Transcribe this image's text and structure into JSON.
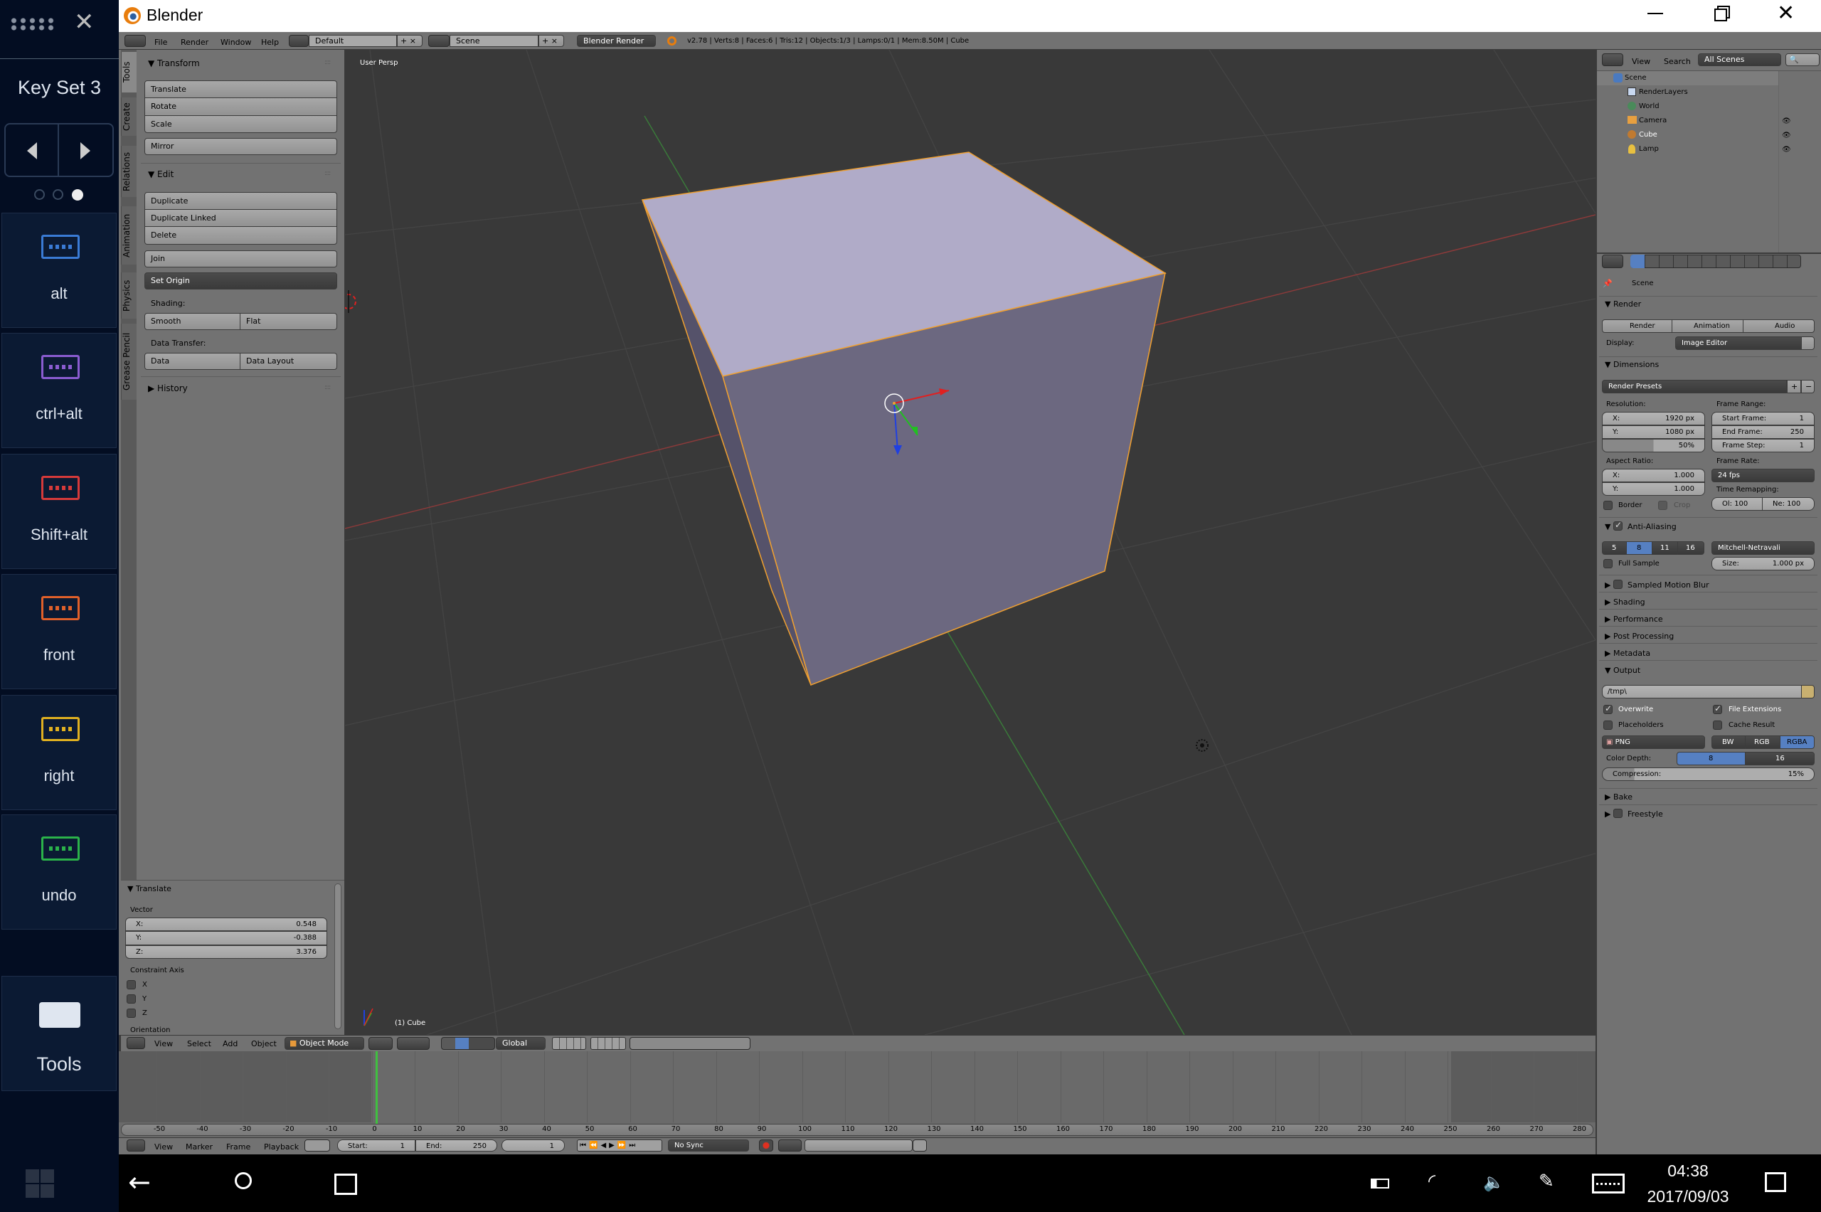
{
  "window": {
    "title": "Blender",
    "minimize_icon": "minimize-icon",
    "restore_icon": "restore-icon",
    "close_icon": "close-icon"
  },
  "osk": {
    "title": "Key Set 3",
    "page_dots": {
      "count": 3,
      "active": 3
    },
    "keys": [
      {
        "label": "alt",
        "color": "#3a7bd5"
      },
      {
        "label": "ctrl+alt",
        "color": "#8a5cd0"
      },
      {
        "label": "Shift+alt",
        "color": "#d63a3a"
      },
      {
        "label": "front",
        "color": "#e0602a"
      },
      {
        "label": "right",
        "color": "#e0b020"
      },
      {
        "label": "undo",
        "color": "#2bb34a"
      }
    ],
    "tools_label": "Tools"
  },
  "info_header": {
    "menus": [
      "File",
      "Render",
      "Window",
      "Help"
    ],
    "layout": "Default",
    "scene": "Scene",
    "engine": "Blender Render",
    "stats": "v2.78 | Verts:8 | Faces:6 | Tris:12 | Objects:1/3 | Lamps:0/1 | Mem:8.50M | Cube"
  },
  "toolshelf": {
    "tabs": [
      "Tools",
      "Create",
      "Relations",
      "Animation",
      "Physics",
      "Grease Pencil"
    ],
    "active_tab": "Tools",
    "transform": {
      "title": "Transform",
      "buttons": [
        "Translate",
        "Rotate",
        "Scale",
        "Mirror"
      ]
    },
    "edit": {
      "title": "Edit",
      "buttons": [
        "Duplicate",
        "Duplicate Linked",
        "Delete",
        "Join"
      ],
      "set_origin": "Set Origin",
      "shading_label": "Shading:",
      "shading": [
        "Smooth",
        "Flat"
      ],
      "data_transfer_label": "Data Transfer:",
      "data_transfer": [
        "Data",
        "Data Layout"
      ]
    },
    "history": {
      "title": "History"
    }
  },
  "operator": {
    "title": "Translate",
    "vector_label": "Vector",
    "vector": [
      {
        "axis": "X:",
        "value": "0.548"
      },
      {
        "axis": "Y:",
        "value": "-0.388"
      },
      {
        "axis": "Z:",
        "value": "3.376"
      }
    ],
    "constraint_label": "Constraint Axis",
    "constraint": [
      {
        "axis": "X",
        "checked": false
      },
      {
        "axis": "Y",
        "checked": false
      },
      {
        "axis": "Z",
        "checked": false
      }
    ],
    "orientation_label": "Orientation"
  },
  "viewport": {
    "view_name": "User Persp",
    "object_label": "(1) Cube",
    "colors": {
      "background": "#393939",
      "cube_top": "#b0abc8",
      "cube_front": "#6c6880",
      "cube_side": "#55526a",
      "selection": "#f0a030"
    }
  },
  "view3d_header": {
    "menus": [
      "View",
      "Select",
      "Add",
      "Object"
    ],
    "mode": "Object Mode",
    "orientation": "Global"
  },
  "timeline": {
    "ruler_labels": [
      -50,
      -40,
      -30,
      -20,
      -10,
      0,
      10,
      20,
      30,
      40,
      50,
      60,
      70,
      80,
      90,
      100,
      110,
      120,
      130,
      140,
      150,
      160,
      170,
      180,
      190,
      200,
      210,
      220,
      230,
      240,
      250,
      260,
      270,
      280
    ],
    "current_frame": 1,
    "menus": [
      "View",
      "Marker",
      "Frame",
      "Playback"
    ],
    "start_label": "Start:",
    "start": "1",
    "end_label": "End:",
    "end": "250",
    "frame": "1",
    "sync": "No Sync"
  },
  "outliner": {
    "menus": [
      "View",
      "Search"
    ],
    "filter": "All Scenes",
    "items": [
      {
        "name": "Scene",
        "depth": 0
      },
      {
        "name": "RenderLayers",
        "depth": 1
      },
      {
        "name": "World",
        "depth": 1
      },
      {
        "name": "Camera",
        "depth": 1
      },
      {
        "name": "Cube",
        "depth": 1
      },
      {
        "name": "Lamp",
        "depth": 1
      }
    ]
  },
  "properties": {
    "context": "Scene",
    "render": {
      "title": "Render",
      "buttons": [
        "Render",
        "Animation",
        "Audio"
      ],
      "display_label": "Display:",
      "display": "Image Editor"
    },
    "dimensions": {
      "title": "Dimensions",
      "presets": "Render Presets",
      "resolution_label": "Resolution:",
      "res_x_label": "X:",
      "res_x": "1920 px",
      "res_y_label": "Y:",
      "res_y": "1080 px",
      "res_pct": "50%",
      "res_pct_value": 50,
      "frame_range_label": "Frame Range:",
      "start_label": "Start Frame:",
      "start": "1",
      "end_label": "End Frame:",
      "end": "250",
      "step_label": "Frame Step:",
      "step": "1",
      "aspect_label": "Aspect Ratio:",
      "asp_x_label": "X:",
      "asp_x": "1.000",
      "asp_y_label": "Y:",
      "asp_y": "1.000",
      "frame_rate_label": "Frame Rate:",
      "frame_rate": "24 fps",
      "border": "Border",
      "crop": "Crop",
      "remap_label": "Time Remapping:",
      "old": "Ol: 100",
      "new": "Ne: 100"
    },
    "aa": {
      "title": "Anti-Aliasing",
      "enabled": true,
      "samples": [
        "5",
        "8",
        "11",
        "16"
      ],
      "selected": "8",
      "filter": "Mitchell-Netravali",
      "full_sample": "Full Sample",
      "size_label": "Size:",
      "size": "1.000 px"
    },
    "collapsed": [
      "Sampled Motion Blur",
      "Shading",
      "Performance",
      "Post Processing",
      "Metadata"
    ],
    "output": {
      "title": "Output",
      "path": "/tmp\\",
      "overwrite": "Overwrite",
      "file_ext": "File Extensions",
      "placeholders": "Placeholders",
      "cache": "Cache Result",
      "format": "PNG",
      "color_modes": [
        "BW",
        "RGB",
        "RGBA"
      ],
      "color_mode": "RGBA",
      "depth_label": "Color Depth:",
      "depths": [
        "8",
        "16"
      ],
      "depth": "8",
      "compression_label": "Compression:",
      "compression": "15%",
      "compression_value": 15
    },
    "tail": [
      "Bake",
      "Freestyle"
    ]
  },
  "taskbar": {
    "time": "04:38",
    "date": "2017/09/03"
  }
}
